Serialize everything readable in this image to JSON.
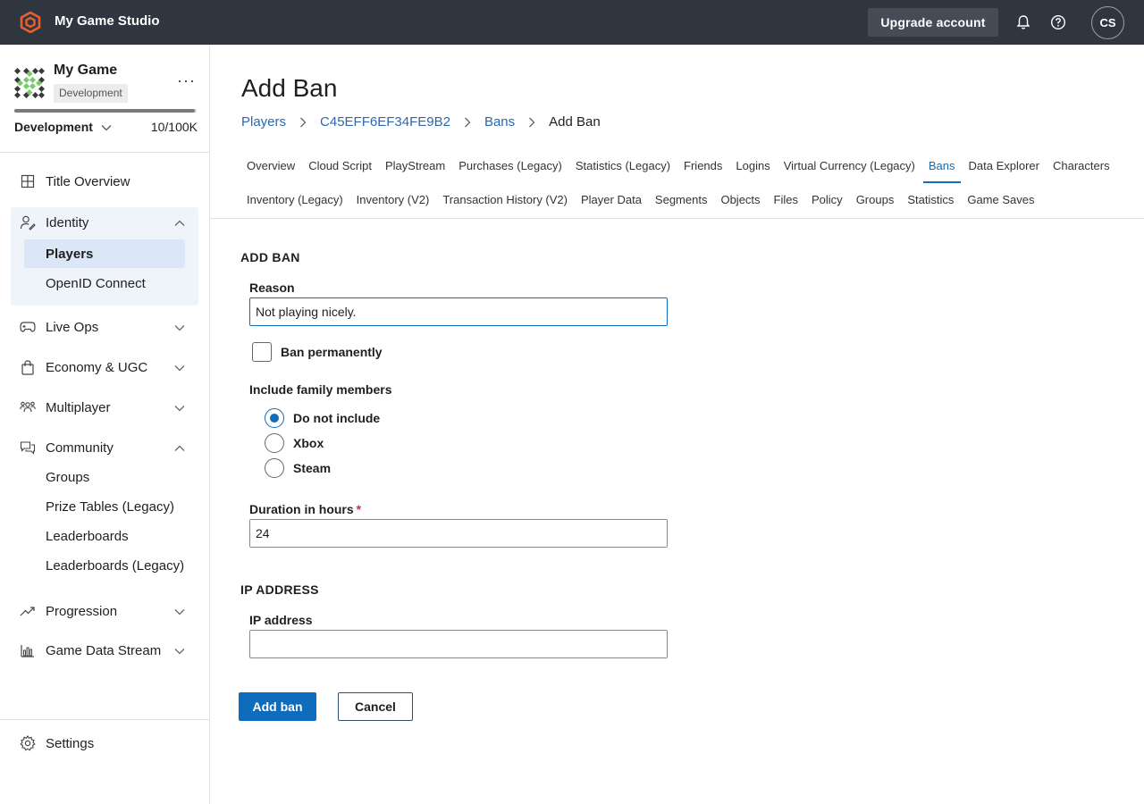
{
  "topbar": {
    "studio_name": "My Game Studio",
    "upgrade_label": "Upgrade account",
    "avatar_initials": "CS",
    "icons": [
      "studio-logo-icon",
      "bell-icon",
      "help-icon"
    ]
  },
  "sidebar": {
    "game_name": "My Game",
    "env_badge": "Development",
    "env_selector": "Development",
    "usage_fraction": 0.99,
    "usage_count": "10/100K",
    "nav": {
      "title_overview": "Title Overview",
      "identity": "Identity",
      "players": "Players",
      "openid": "OpenID Connect",
      "live_ops": "Live Ops",
      "economy": "Economy & UGC",
      "multiplayer": "Multiplayer",
      "community": "Community",
      "groups": "Groups",
      "prize_tables": "Prize Tables (Legacy)",
      "leaderboards": "Leaderboards",
      "leaderboards_legacy": "Leaderboards (Legacy)",
      "progression": "Progression",
      "game_data_stream": "Game Data Stream",
      "settings": "Settings"
    }
  },
  "main": {
    "title": "Add Ban",
    "breadcrumb": {
      "players": "Players",
      "player_id": "C45EFF6EF34FE9B2",
      "bans": "Bans",
      "current": "Add Ban"
    },
    "tabs_row1": [
      "Overview",
      "Cloud Script",
      "PlayStream",
      "Purchases (Legacy)",
      "Statistics (Legacy)",
      "Friends",
      "Logins",
      "Virtual Currency (Legacy)",
      "Bans",
      "Data Explorer",
      "Characters"
    ],
    "tabs_row2": [
      "Inventory (Legacy)",
      "Inventory (V2)",
      "Transaction History (V2)",
      "Player Data",
      "Segments",
      "Objects",
      "Files",
      "Policy",
      "Groups",
      "Statistics",
      "Game Saves"
    ],
    "active_tab": "Bans",
    "form": {
      "section_add_ban": "ADD BAN",
      "reason_label": "Reason",
      "reason_value": "Not playing nicely.",
      "ban_permanently_label": "Ban permanently",
      "ban_permanently_checked": false,
      "family_label": "Include family members",
      "family_options": [
        "Do not include",
        "Xbox",
        "Steam"
      ],
      "family_selected": "Do not include",
      "duration_label": "Duration in hours",
      "duration_required_mark": "*",
      "duration_value": "24",
      "section_ip": "IP ADDRESS",
      "ip_label": "IP address",
      "ip_value": "",
      "submit_label": "Add ban",
      "cancel_label": "Cancel"
    }
  },
  "colors": {
    "topbar_bg": "#2f3640",
    "accent": "#0f6cbd",
    "link": "#2c68b2",
    "brand_orange": "#e8612c",
    "required": "#c4314b"
  }
}
